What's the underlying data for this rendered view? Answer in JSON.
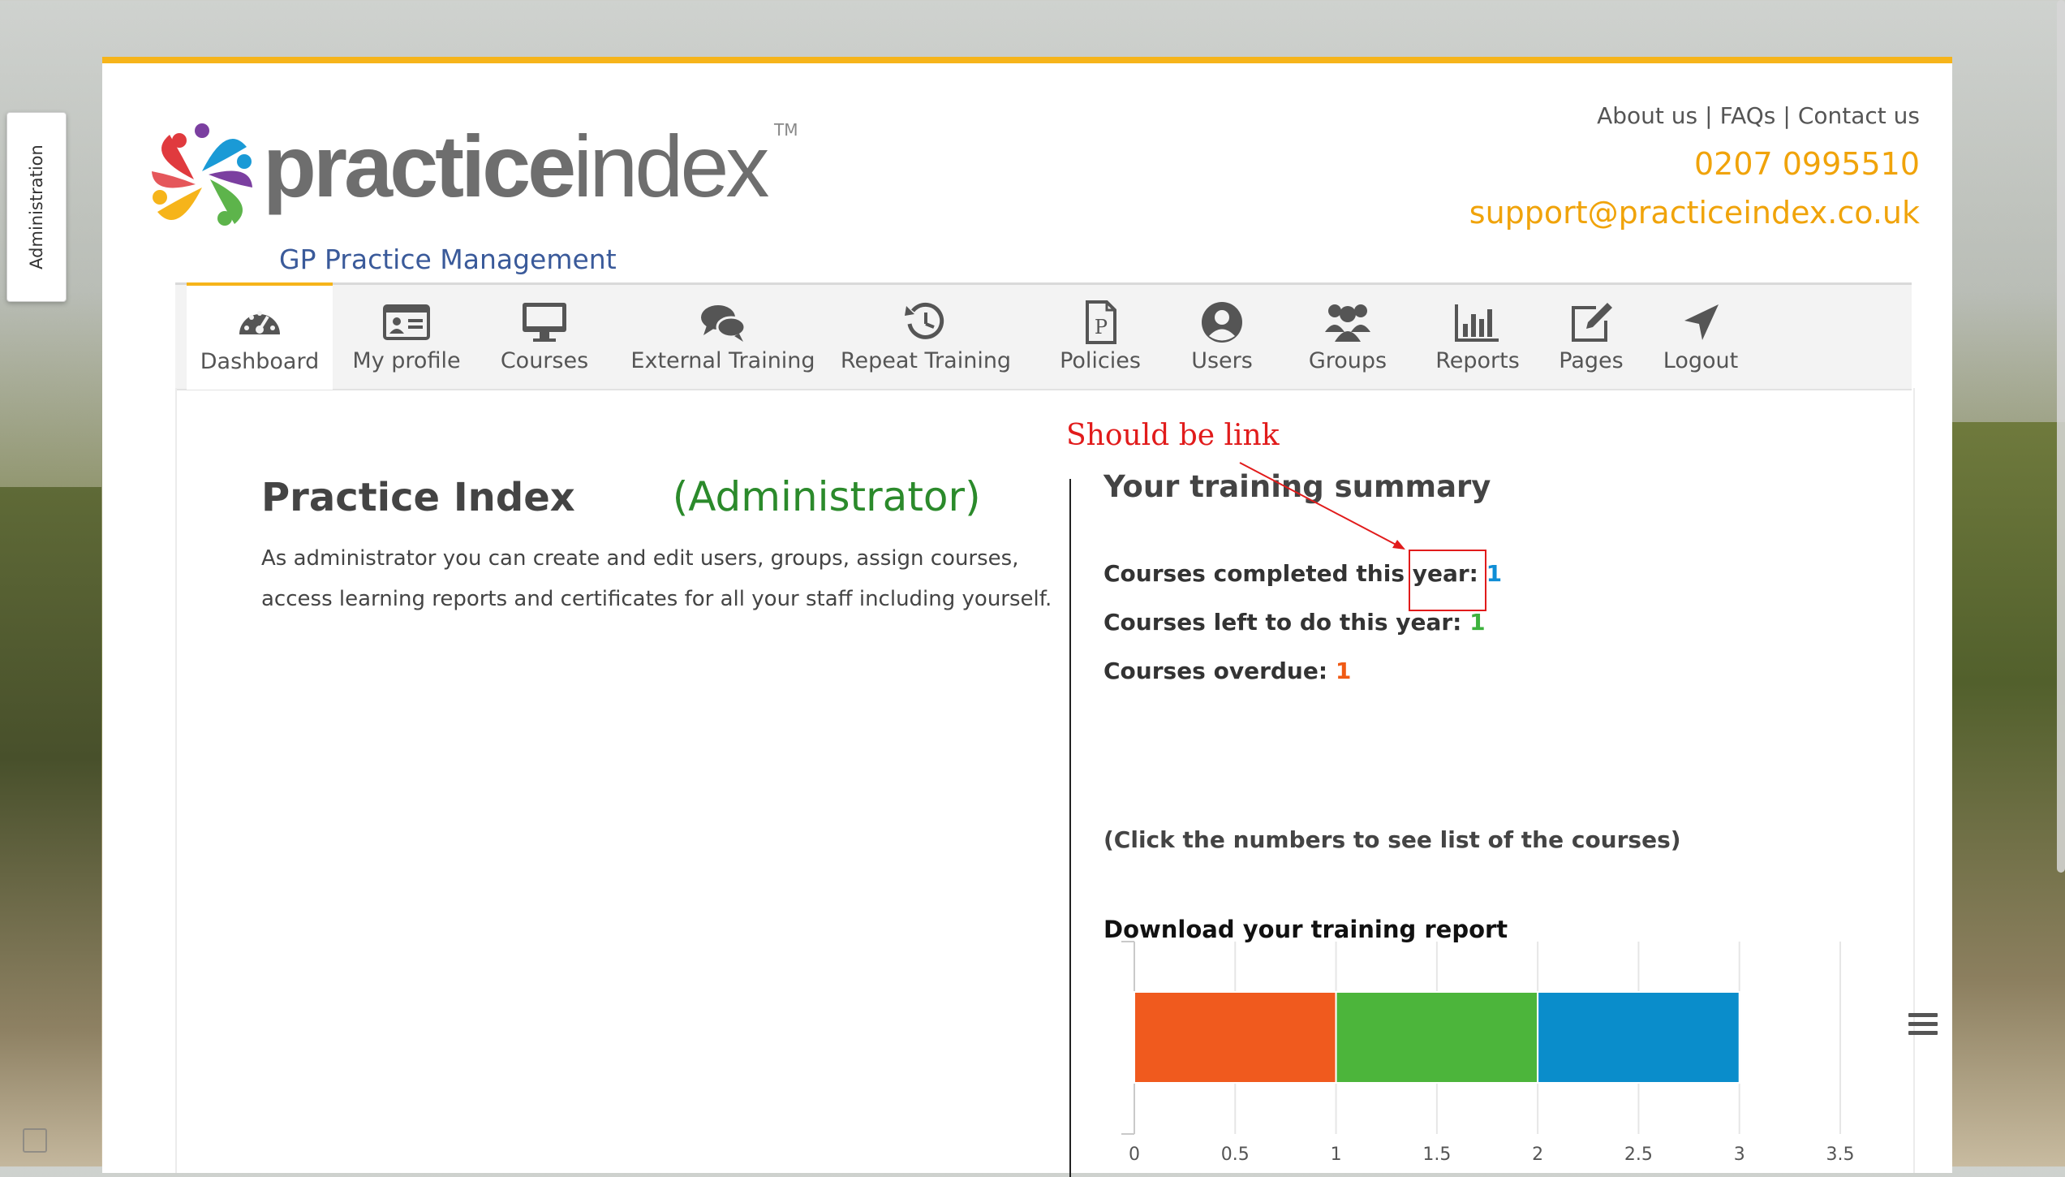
{
  "admin_tab": {
    "label": "Administration"
  },
  "header": {
    "logo": {
      "word_a": "practice",
      "word_b": "index",
      "tm": "TM",
      "tagline": "GP Practice Management",
      "colors": [
        "#e03a3e",
        "#f6b41a",
        "#5db44b",
        "#1a9ad6",
        "#7b3fa0"
      ]
    },
    "links": {
      "about": "About us",
      "faqs": "FAQs",
      "contact": "Contact us",
      "separator": "|"
    },
    "phone": "0207 0995510",
    "email": "support@practiceindex.co.uk"
  },
  "nav": {
    "items": [
      {
        "label": "Dashboard",
        "icon": "dashboard-icon"
      },
      {
        "label": "My profile",
        "icon": "id-card-icon"
      },
      {
        "label": "Courses",
        "icon": "monitor-icon"
      },
      {
        "label": "External Training",
        "icon": "chat-bubbles-icon"
      },
      {
        "label": "Repeat Training",
        "icon": "history-icon"
      },
      {
        "label": "Policies",
        "icon": "document-p-icon"
      },
      {
        "label": "Users",
        "icon": "user-circle-icon"
      },
      {
        "label": "Groups",
        "icon": "group-icon"
      },
      {
        "label": "Reports",
        "icon": "bar-chart-icon"
      },
      {
        "label": "Pages",
        "icon": "edit-icon"
      },
      {
        "label": "Logout",
        "icon": "location-arrow-icon"
      }
    ],
    "active": "Dashboard",
    "accent": "#f6b41a"
  },
  "main": {
    "title": "Practice Index",
    "role": "(Administrator)",
    "description_line1": "As administrator you can create and edit users, groups, assign courses,",
    "description_line2": "access learning reports and certificates for all your staff including yourself."
  },
  "summary": {
    "title": "Your training summary",
    "completed": {
      "label": "Courses completed this year:",
      "value": "1"
    },
    "left": {
      "label": "Courses left to do this year:",
      "value": "1"
    },
    "overdue": {
      "label": "Courses overdue:",
      "value": "1"
    },
    "hint": "(Click the numbers to see list of the courses)",
    "download": "Download your training report"
  },
  "annotation": {
    "text": "Should be link",
    "color": "#e11b1b"
  },
  "chart_data": {
    "type": "bar",
    "orientation": "horizontal",
    "stacked": true,
    "categories": [
      ""
    ],
    "series": [
      {
        "values": [
          1
        ],
        "color": "#f05a1e"
      },
      {
        "values": [
          1
        ],
        "color": "#4cb53b"
      },
      {
        "values": [
          1
        ],
        "color": "#0a8dcb"
      }
    ],
    "xlim": [
      0,
      3.5
    ],
    "xticks": [
      "0",
      "0.5",
      "1",
      "1.5",
      "2",
      "2.5",
      "3",
      "3.5"
    ],
    "grid": true,
    "title": "",
    "xlabel": "",
    "ylabel": ""
  }
}
